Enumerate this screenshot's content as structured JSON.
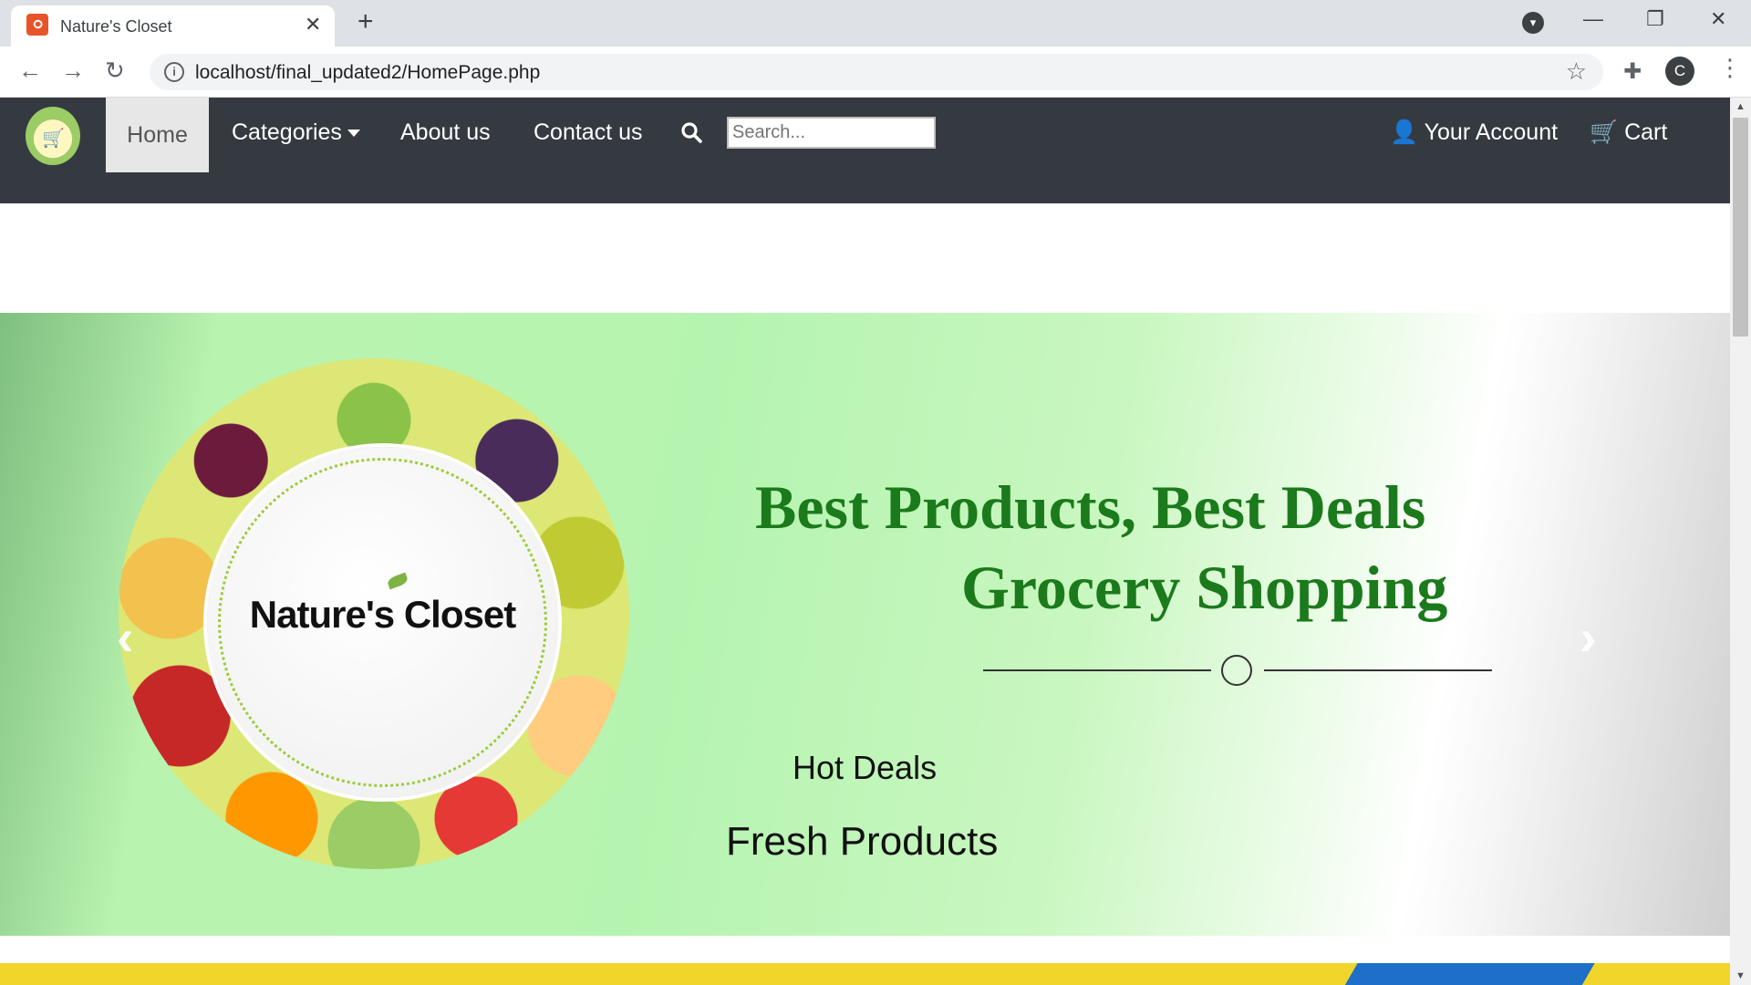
{
  "browser": {
    "tab_title": "Nature's Closet",
    "tab_close": "✕",
    "new_tab": "+",
    "profile_dropdown": "▾",
    "window_controls": [
      "—",
      "❐",
      "✕"
    ],
    "url": "localhost/final_updated2/HomePage.php",
    "avatar_letter": "C"
  },
  "site_nav": {
    "home": "Home",
    "categories": "Categories",
    "about": "About us",
    "contact": "Contact us",
    "search_placeholder": "Search...",
    "account": "Your Account",
    "cart": "Cart"
  },
  "hero": {
    "brand": "Nature's Closet",
    "headline_line1": "Best Products, Best Deals",
    "headline_line2": "Grocery Shopping",
    "sub1": "Hot Deals",
    "sub2": "Fresh Products",
    "prev_arrow": "‹",
    "next_arrow": "›",
    "slide_count": 2,
    "active_slide": 1
  },
  "colors": {
    "nav_bg": "#343a40",
    "headline": "#1b7a1b",
    "hero_green": "#b5f4b0",
    "band_yellow": "#f2d52a"
  }
}
